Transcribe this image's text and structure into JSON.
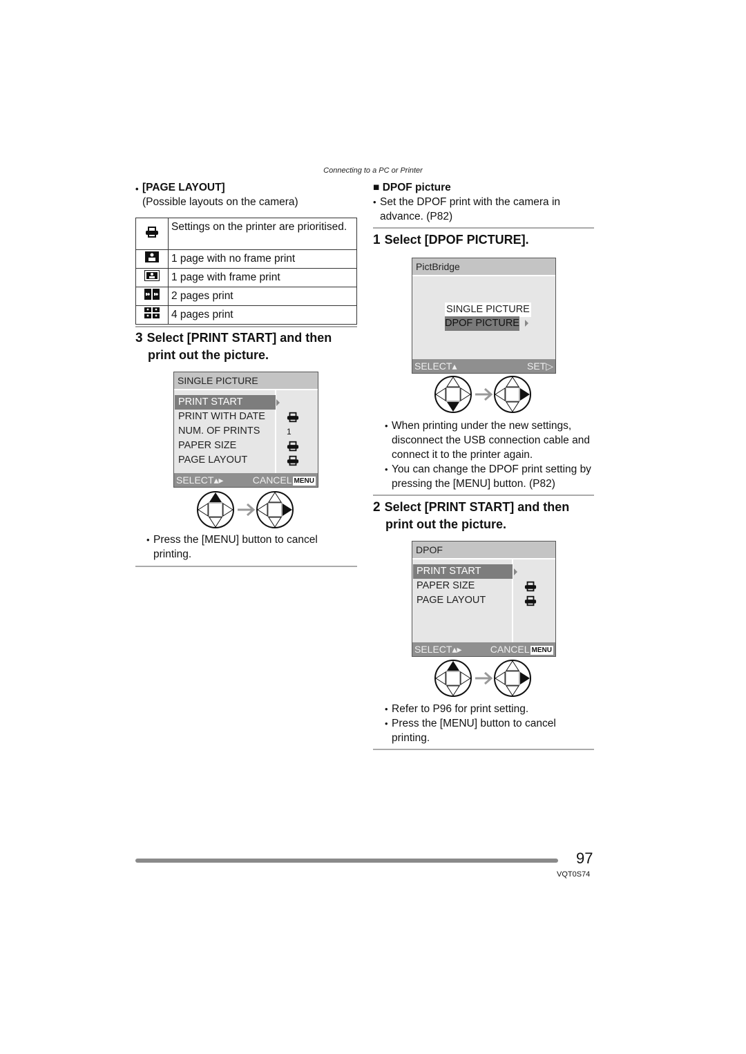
{
  "header": {
    "section": "Connecting to a PC or Printer"
  },
  "left": {
    "page_layout": {
      "heading": "[PAGE LAYOUT]",
      "subtitle": "(Possible layouts on the camera)",
      "rows": [
        {
          "icon": "printer-icon",
          "text": "Settings on the printer are prioritised."
        },
        {
          "icon": "no-frame-layout-icon",
          "text": "1 page with no frame print"
        },
        {
          "icon": "frame-layout-icon",
          "text": "1 page with frame print"
        },
        {
          "icon": "two-pages-layout-icon",
          "text": "2 pages print"
        },
        {
          "icon": "four-pages-layout-icon",
          "text": "4 pages print"
        }
      ]
    },
    "step3": {
      "number": "3",
      "title_line1": "Select [PRINT START] and then",
      "title_line2": "print out the picture."
    },
    "screen": {
      "title": "SINGLE PICTURE",
      "items": [
        {
          "label": "PRINT START",
          "value": "",
          "selected": true
        },
        {
          "label": "PRINT WITH DATE",
          "value": "printer-icon"
        },
        {
          "label": "NUM. OF PRINTS",
          "value": "1"
        },
        {
          "label": "PAPER SIZE",
          "value": "printer-icon"
        },
        {
          "label": "PAGE LAYOUT",
          "value": "printer-icon"
        }
      ],
      "footer_left": "SELECT",
      "footer_right": "CANCEL",
      "menu_badge": "MENU"
    },
    "dpad": {
      "from_active": "up",
      "to_active": "right"
    },
    "notes": [
      "Press the [MENU] button to cancel printing."
    ]
  },
  "right": {
    "dpof": {
      "heading": "DPOF picture",
      "note": "Set the DPOF print with the camera in advance. (P82)"
    },
    "step1": {
      "number": "1",
      "title": "Select [DPOF PICTURE]."
    },
    "screen1": {
      "title": "PictBridge",
      "options": [
        {
          "label": "SINGLE PICTURE",
          "selected": false
        },
        {
          "label": "DPOF PICTURE",
          "selected": true
        }
      ],
      "footer_left": "SELECT",
      "footer_right": "SET"
    },
    "dpad1": {
      "from_active": "down",
      "to_active": "right"
    },
    "notes1": [
      "When printing under the new settings, disconnect the USB connection cable and connect it to the printer again.",
      "You can change the DPOF print setting by pressing the [MENU] button. (P82)"
    ],
    "step2": {
      "number": "2",
      "title_line1": "Select [PRINT START] and then",
      "title_line2": "print out the picture."
    },
    "screen2": {
      "title": "DPOF",
      "items": [
        {
          "label": "PRINT START",
          "value": "",
          "selected": true
        },
        {
          "label": "PAPER SIZE",
          "value": "printer-icon"
        },
        {
          "label": "PAGE LAYOUT",
          "value": "printer-icon"
        }
      ],
      "footer_left": "SELECT",
      "footer_right": "CANCEL",
      "menu_badge": "MENU"
    },
    "dpad2": {
      "from_active": "up",
      "to_active": "right"
    },
    "notes2": [
      "Refer to P96 for print setting.",
      "Press the [MENU] button to cancel printing."
    ]
  },
  "footer": {
    "page_number": "97",
    "code": "VQT0S74"
  }
}
